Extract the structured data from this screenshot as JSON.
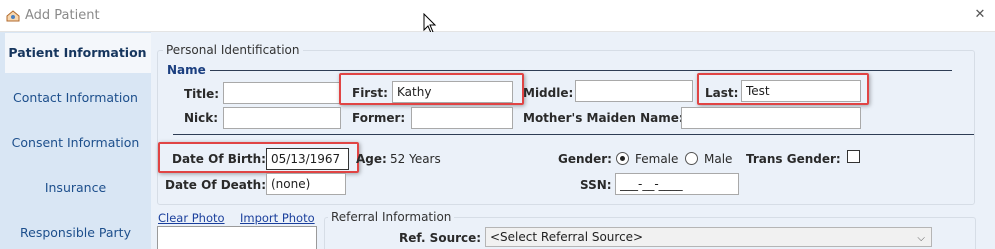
{
  "window": {
    "title": "Add Patient",
    "close_glyph": "✕"
  },
  "nav": {
    "items": [
      {
        "label": "Patient Information",
        "active": true
      },
      {
        "label": "Contact Information",
        "active": false
      },
      {
        "label": "Consent Information",
        "active": false
      },
      {
        "label": "Insurance",
        "active": false
      },
      {
        "label": "Responsible Party",
        "active": false
      }
    ]
  },
  "personal_identification": {
    "group_label": "Personal Identification",
    "name_section": "Name",
    "title_label": "Title:",
    "title_value": "",
    "first_label": "First:",
    "first_value": "Kathy",
    "middle_label": "Middle:",
    "middle_value": "",
    "last_label": "Last:",
    "last_value": "Test",
    "nick_label": "Nick:",
    "nick_value": "",
    "former_label": "Former:",
    "former_value": "",
    "maiden_label": "Mother's  Maiden Name:",
    "maiden_value": "",
    "dob_label": "Date Of Birth:",
    "dob_value": "05/13/1967",
    "age_label": "Age:",
    "age_value": "52 Years",
    "gender_label": "Gender:",
    "gender_options": [
      "Female",
      "Male"
    ],
    "gender_selected": "Female",
    "trans_label": "Trans Gender:",
    "trans_checked": false,
    "dod_label": "Date Of Death:",
    "dod_value": "(none)",
    "ssn_label": "SSN:",
    "ssn_value": "___-__-____"
  },
  "photo": {
    "clear_label": "Clear  Photo",
    "import_label": "Import  Photo"
  },
  "referral": {
    "group_label": "Referral Information",
    "source_label": "Ref. Source:",
    "source_value": "<Select Referral Source>"
  },
  "colors": {
    "nav_bg": "#d9e6f4",
    "content_bg": "#ebf1f9",
    "highlight": "#e04444",
    "section_text": "#1b3f80"
  },
  "icons": {
    "app": "app-logo-icon",
    "close": "close-icon",
    "cursor": "mouse-pointer-icon",
    "dropdown": "chevron-down-icon"
  }
}
